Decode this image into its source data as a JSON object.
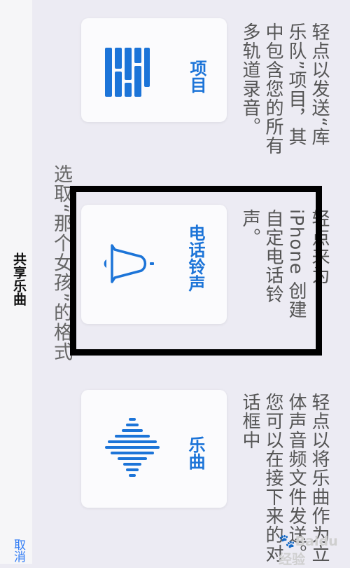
{
  "nav": {
    "cancel": "取消",
    "title": "共享乐曲"
  },
  "subtitle": "选取“那个女孩”的格式",
  "options": [
    {
      "label": "项目",
      "description": "轻点以发送“库乐队”项目，其中包含您的所有多轨道录音。",
      "icon": "tracks-icon"
    },
    {
      "label": "电话铃声",
      "description": "轻点来为 iPhone 创建自定电话铃声。",
      "icon": "bell-icon"
    },
    {
      "label": "乐曲",
      "description": "轻点以将乐曲作为立体声音频文件发送。您可以在接下来的对话框中",
      "icon": "waveform-icon"
    }
  ],
  "colors": {
    "accent": "#1c74d8",
    "cancel": "#2f7bf5",
    "highlight": "#000000"
  },
  "watermark": {
    "text": "Baidu经验"
  }
}
